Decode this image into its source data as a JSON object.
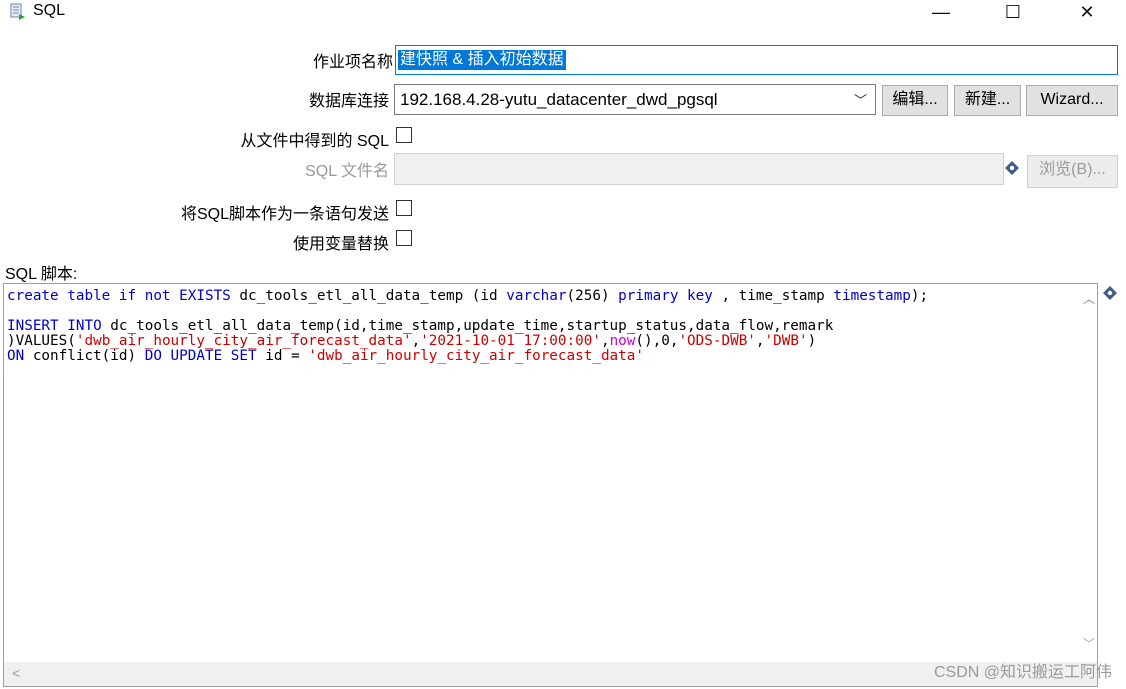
{
  "window": {
    "title": "SQL",
    "minimize_glyph": "—",
    "maximize_glyph": "☐",
    "close_glyph": "✕"
  },
  "form": {
    "step_name_label": "作业项名称",
    "step_name_value": "建快照 & 插入初始数据",
    "connection_label": "数据库连接",
    "connection_value": "192.168.4.28-yutu_datacenter_dwd_pgsql",
    "edit_button": "编辑...",
    "new_button": "新建...",
    "wizard_button": "Wizard...",
    "sql_from_file_label": "从文件中得到的 SQL",
    "sql_filename_label": "SQL 文件名",
    "browse_button": "浏览(B)...",
    "send_single_label": "将SQL脚本作为一条语句发送",
    "variable_substitution_label": "使用变量替换",
    "sql_script_label": "SQL 脚本:"
  },
  "script": {
    "l1_kw1": "create table if not EXISTS",
    "l1_t1": " dc_tools_etl_all_data_temp (id ",
    "l1_kw2": "varchar",
    "l1_t2": "(256) ",
    "l1_kw3": "primary key",
    "l1_t3": " , time_stamp ",
    "l1_kw4": "timestamp",
    "l1_t4": ");",
    "l3_kw1": "INSERT INTO",
    "l3_t1": " dc_tools_etl_all_data_temp(id,time_stamp,update_time,startup_status,data_flow,remark",
    "l4_t1": ")VALUES(",
    "l4_s1": "'dwb_air_hourly_city_air_forecast_data'",
    "l4_t2": ",",
    "l4_s2": "'2021-10-01 17:00:00'",
    "l4_t3": ",",
    "l4_fn": "now",
    "l4_t4": "(),0,",
    "l4_s3": "'ODS-DWB'",
    "l4_t5": ",",
    "l4_s4": "'DWB'",
    "l4_t6": ")",
    "l5_kw1": "ON",
    "l5_t1": " conflict(id) ",
    "l5_kw2": "DO UPDATE SET",
    "l5_t2": " id = ",
    "l5_s1": "'dwb_air_hourly_city_air_forecast_data'"
  },
  "watermark": "CSDN @知识搬运工阿伟",
  "icons": [
    "sql-app-icon",
    "variable-diamond-icon",
    "scroll-up-icon",
    "scroll-down-icon",
    "scroll-left-icon"
  ]
}
